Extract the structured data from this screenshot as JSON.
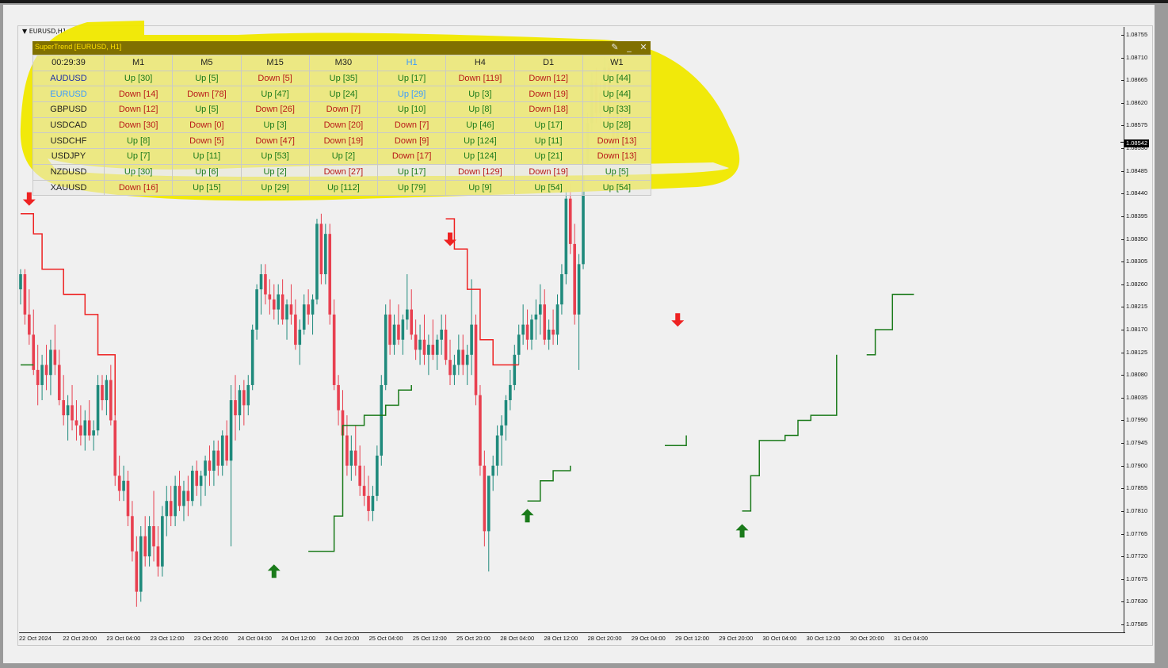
{
  "window": {
    "title": "EURUSD,H1"
  },
  "panel": {
    "title": "SuperTrend [EURUSD, H1]",
    "pin_icon": "pin-icon",
    "minimize_icon": "minimize-icon",
    "close_icon": "close-icon",
    "timer": "00:29:39",
    "timeframes": [
      "M1",
      "M5",
      "M15",
      "M30",
      "H1",
      "H4",
      "D1",
      "W1"
    ],
    "active_timeframe": "H1",
    "active_pair": "EURUSD",
    "rows": [
      {
        "pair": "AUDUSD",
        "cells": [
          "Up [30]",
          "Up [5]",
          "Down [5]",
          "Up [35]",
          "Up [17]",
          "Down [119]",
          "Down [12]",
          "Up [44]"
        ]
      },
      {
        "pair": "EURUSD",
        "cells": [
          "Down [14]",
          "Down [78]",
          "Up [47]",
          "Up [24]",
          "Up [29]",
          "Up [3]",
          "Down [19]",
          "Up [44]"
        ]
      },
      {
        "pair": "GBPUSD",
        "cells": [
          "Down [12]",
          "Up [5]",
          "Down [26]",
          "Down [7]",
          "Up [10]",
          "Up [8]",
          "Down [18]",
          "Up [33]"
        ]
      },
      {
        "pair": "USDCAD",
        "cells": [
          "Down [30]",
          "Down [0]",
          "Up [3]",
          "Down [20]",
          "Down [7]",
          "Up [46]",
          "Up [17]",
          "Up [28]"
        ]
      },
      {
        "pair": "USDCHF",
        "cells": [
          "Up [8]",
          "Down [5]",
          "Down [47]",
          "Down [19]",
          "Down [9]",
          "Up [124]",
          "Up [11]",
          "Down [13]"
        ]
      },
      {
        "pair": "USDJPY",
        "cells": [
          "Up [7]",
          "Up [11]",
          "Up [53]",
          "Up [2]",
          "Down [17]",
          "Up [124]",
          "Up [21]",
          "Down [13]"
        ]
      },
      {
        "pair": "NZDUSD",
        "cells": [
          "Up [30]",
          "Up [6]",
          "Up [2]",
          "Down [27]",
          "Up [17]",
          "Down [129]",
          "Down [19]",
          "Up [5]"
        ]
      },
      {
        "pair": "XAUUSD",
        "cells": [
          "Down [16]",
          "Up [15]",
          "Up [29]",
          "Up [112]",
          "Up [79]",
          "Up [9]",
          "Up [54]",
          "Up [54]"
        ]
      }
    ]
  },
  "y_axis": {
    "labels": [
      "1.08755",
      "1.08710",
      "1.08665",
      "1.08620",
      "1.08575",
      "1.08530",
      "1.08485",
      "1.08440",
      "1.08395",
      "1.08350",
      "1.08305",
      "1.08260",
      "1.08215",
      "1.08170",
      "1.08125",
      "1.08080",
      "1.08035",
      "1.07990",
      "1.07945",
      "1.07900",
      "1.07855",
      "1.07810",
      "1.07765",
      "1.07720",
      "1.07675",
      "1.07630",
      "1.07585"
    ],
    "current_price": "1.08542"
  },
  "x_axis": {
    "labels": [
      "22 Oct 2024",
      "22 Oct 20:00",
      "23 Oct 04:00",
      "23 Oct 12:00",
      "23 Oct 20:00",
      "24 Oct 04:00",
      "24 Oct 12:00",
      "24 Oct 20:00",
      "25 Oct 04:00",
      "25 Oct 12:00",
      "25 Oct 20:00",
      "28 Oct 04:00",
      "28 Oct 12:00",
      "28 Oct 20:00",
      "29 Oct 04:00",
      "29 Oct 12:00",
      "29 Oct 20:00",
      "30 Oct 04:00",
      "30 Oct 12:00",
      "30 Oct 20:00",
      "31 Oct 04:00"
    ]
  },
  "colors": {
    "bull": "#1f8a7c",
    "bear": "#e84050",
    "supertrend_up": "#1a7a1a",
    "supertrend_down": "#ee2222",
    "highlight": "#f0e800",
    "panel_header": "#807000",
    "active_cell": "#3a9bff"
  },
  "chart_data": {
    "type": "candlestick",
    "symbol": "EURUSD",
    "timeframe": "H1",
    "ylim": [
      1.07585,
      1.08755
    ],
    "current_price": 1.08542,
    "supertrend_up": [
      [
        0,
        1.081
      ],
      [
        3,
        1.081
      ],
      [
        59,
        1.0773
      ],
      [
        67,
        1.0773
      ],
      [
        73,
        1.078
      ],
      [
        75,
        1.0798
      ],
      [
        80,
        1.08
      ],
      [
        85,
        1.0802
      ],
      [
        88,
        1.0805
      ],
      [
        91,
        1.0806
      ],
      [
        99,
        1.0806
      ],
      [
        118,
        1.0783
      ],
      [
        121,
        1.0787
      ],
      [
        124,
        1.0789
      ],
      [
        128,
        1.079
      ],
      [
        140,
        1.0793
      ],
      [
        150,
        1.0794
      ],
      [
        155,
        1.0796
      ],
      [
        168,
        1.0781
      ],
      [
        170,
        1.0788
      ],
      [
        172,
        1.0795
      ],
      [
        178,
        1.0796
      ],
      [
        181,
        1.0799
      ],
      [
        184,
        1.08
      ],
      [
        190,
        1.0812
      ],
      [
        197,
        1.0812
      ],
      [
        199,
        1.0817
      ],
      [
        203,
        1.0824
      ],
      [
        208,
        1.0824
      ]
    ],
    "supertrend_down": [
      [
        0,
        1.084
      ],
      [
        3,
        1.0836
      ],
      [
        5,
        1.0829
      ],
      [
        10,
        1.0824
      ],
      [
        15,
        1.082
      ],
      [
        18,
        1.0812
      ],
      [
        22,
        1.08
      ],
      [
        33,
        1.0798
      ],
      [
        58,
        1.0798
      ],
      [
        99,
        1.0839
      ],
      [
        101,
        1.0833
      ],
      [
        104,
        1.0825
      ],
      [
        107,
        1.0815
      ],
      [
        110,
        1.081
      ],
      [
        116,
        1.081
      ],
      [
        155,
        1.0817
      ],
      [
        163,
        1.0817
      ]
    ],
    "arrows": [
      {
        "i": 2,
        "dir": "down",
        "price": 1.0843
      },
      {
        "i": 59,
        "dir": "up",
        "price": 1.0769
      },
      {
        "i": 100,
        "dir": "down",
        "price": 1.0835
      },
      {
        "i": 118,
        "dir": "up",
        "price": 1.078
      },
      {
        "i": 153,
        "dir": "down",
        "price": 1.0819
      },
      {
        "i": 168,
        "dir": "up",
        "price": 1.0777
      }
    ],
    "candles": [
      [
        1.0825,
        1.0829,
        1.0822,
        1.0828
      ],
      [
        1.0828,
        1.0829,
        1.0818,
        1.082
      ],
      [
        1.082,
        1.0825,
        1.0814,
        1.0816
      ],
      [
        1.0816,
        1.0821,
        1.0808,
        1.0809
      ],
      [
        1.0809,
        1.0814,
        1.0802,
        1.0806
      ],
      [
        1.0806,
        1.0812,
        1.0803,
        1.081
      ],
      [
        1.081,
        1.0814,
        1.0805,
        1.0808
      ],
      [
        1.0808,
        1.0815,
        1.0804,
        1.0813
      ],
      [
        1.0813,
        1.0818,
        1.0808,
        1.081
      ],
      [
        1.081,
        1.0813,
        1.0802,
        1.0803
      ],
      [
        1.0803,
        1.0808,
        1.0798,
        1.08
      ],
      [
        1.08,
        1.0804,
        1.0795,
        1.0802
      ],
      [
        1.0802,
        1.0806,
        1.0797,
        1.0799
      ],
      [
        1.0799,
        1.0803,
        1.0795,
        1.0798
      ],
      [
        1.0798,
        1.0802,
        1.0794,
        1.0796
      ],
      [
        1.0796,
        1.0801,
        1.0793,
        1.0799
      ],
      [
        1.0799,
        1.0803,
        1.0795,
        1.0796
      ],
      [
        1.0796,
        1.0799,
        1.0793,
        1.0797
      ],
      [
        1.0797,
        1.0808,
        1.0796,
        1.0806
      ],
      [
        1.0806,
        1.0808,
        1.0801,
        1.0803
      ],
      [
        1.0803,
        1.0808,
        1.08,
        1.0807
      ],
      [
        1.0807,
        1.081,
        1.0798,
        1.0799
      ],
      [
        1.0799,
        1.0802,
        1.0786,
        1.0788
      ],
      [
        1.0788,
        1.0792,
        1.0783,
        1.0785
      ],
      [
        1.0785,
        1.079,
        1.0783,
        1.0787
      ],
      [
        1.0787,
        1.0789,
        1.0778,
        1.078
      ],
      [
        1.078,
        1.0783,
        1.0771,
        1.0773
      ],
      [
        1.0773,
        1.0776,
        1.0762,
        1.0765
      ],
      [
        1.0765,
        1.0778,
        1.0763,
        1.0776
      ],
      [
        1.0776,
        1.078,
        1.077,
        1.0772
      ],
      [
        1.0772,
        1.078,
        1.077,
        1.0778
      ],
      [
        1.0778,
        1.0785,
        1.0771,
        1.0774
      ],
      [
        1.0774,
        1.0778,
        1.0768,
        1.077
      ],
      [
        1.077,
        1.0782,
        1.0768,
        1.078
      ],
      [
        1.078,
        1.0786,
        1.0776,
        1.0783
      ],
      [
        1.0783,
        1.0786,
        1.0778,
        1.078
      ],
      [
        1.078,
        1.0788,
        1.0778,
        1.0786
      ],
      [
        1.0786,
        1.0789,
        1.0781,
        1.0782
      ],
      [
        1.0782,
        1.0787,
        1.0779,
        1.0785
      ],
      [
        1.0785,
        1.0788,
        1.078,
        1.0783
      ],
      [
        1.0783,
        1.079,
        1.0782,
        1.0789
      ],
      [
        1.0789,
        1.0791,
        1.0784,
        1.0786
      ],
      [
        1.0786,
        1.0789,
        1.0782,
        1.0788
      ],
      [
        1.0788,
        1.0792,
        1.0784,
        1.0791
      ],
      [
        1.0791,
        1.0794,
        1.0786,
        1.0789
      ],
      [
        1.0789,
        1.0795,
        1.0786,
        1.0793
      ],
      [
        1.0793,
        1.0795,
        1.0788,
        1.079
      ],
      [
        1.079,
        1.0797,
        1.0788,
        1.0796
      ],
      [
        1.0796,
        1.0799,
        1.079,
        1.0791
      ],
      [
        1.0791,
        1.0806,
        1.0774,
        1.0803
      ],
      [
        1.0803,
        1.0808,
        1.0795,
        1.08
      ],
      [
        1.08,
        1.0806,
        1.0797,
        1.0805
      ],
      [
        1.0805,
        1.0807,
        1.0798,
        1.0802
      ],
      [
        1.0802,
        1.0808,
        1.08,
        1.0806
      ],
      [
        1.0806,
        1.0818,
        1.0805,
        1.0817
      ],
      [
        1.0817,
        1.0826,
        1.0815,
        1.0825
      ],
      [
        1.0825,
        1.083,
        1.082,
        1.0828
      ],
      [
        1.0828,
        1.083,
        1.0822,
        1.0824
      ],
      [
        1.0824,
        1.0827,
        1.082,
        1.0823
      ],
      [
        1.0823,
        1.0826,
        1.0819,
        1.0821
      ],
      [
        1.0821,
        1.0826,
        1.0818,
        1.0824
      ],
      [
        1.0824,
        1.0827,
        1.0818,
        1.0819
      ],
      [
        1.0819,
        1.0823,
        1.0815,
        1.0822
      ],
      [
        1.0822,
        1.0826,
        1.0818,
        1.082
      ],
      [
        1.082,
        1.0823,
        1.0813,
        1.0814
      ],
      [
        1.0814,
        1.0819,
        1.081,
        1.0817
      ],
      [
        1.0817,
        1.0824,
        1.0816,
        1.0822
      ],
      [
        1.0822,
        1.0825,
        1.0818,
        1.082
      ],
      [
        1.082,
        1.0824,
        1.0816,
        1.0823
      ],
      [
        1.0823,
        1.0839,
        1.0822,
        1.0838
      ],
      [
        1.0838,
        1.084,
        1.0826,
        1.0828
      ],
      [
        1.0828,
        1.0838,
        1.0826,
        1.0836
      ],
      [
        1.0836,
        1.0838,
        1.0818,
        1.082
      ],
      [
        1.082,
        1.0823,
        1.0805,
        1.0806
      ],
      [
        1.0806,
        1.0808,
        1.0798,
        1.0801
      ],
      [
        1.0801,
        1.0805,
        1.0794,
        1.0796
      ],
      [
        1.0796,
        1.08,
        1.0788,
        1.079
      ],
      [
        1.079,
        1.0796,
        1.0787,
        1.0793
      ],
      [
        1.0793,
        1.0798,
        1.0788,
        1.079
      ],
      [
        1.079,
        1.0794,
        1.0784,
        1.0786
      ],
      [
        1.0786,
        1.079,
        1.0782,
        1.0784
      ],
      [
        1.0784,
        1.0788,
        1.0779,
        1.0781
      ],
      [
        1.0781,
        1.0786,
        1.0779,
        1.0784
      ],
      [
        1.0784,
        1.0794,
        1.0783,
        1.0792
      ],
      [
        1.0792,
        1.0808,
        1.079,
        1.0806
      ],
      [
        1.0806,
        1.0822,
        1.0805,
        1.082
      ],
      [
        1.082,
        1.0823,
        1.0812,
        1.0814
      ],
      [
        1.0814,
        1.082,
        1.0812,
        1.0818
      ],
      [
        1.0818,
        1.0822,
        1.0814,
        1.0815
      ],
      [
        1.0815,
        1.082,
        1.0812,
        1.0819
      ],
      [
        1.0819,
        1.0828,
        1.0817,
        1.0821
      ],
      [
        1.0821,
        1.0825,
        1.0815,
        1.0816
      ],
      [
        1.0816,
        1.0819,
        1.0811,
        1.0813
      ],
      [
        1.0813,
        1.0818,
        1.081,
        1.0815
      ],
      [
        1.0815,
        1.082,
        1.081,
        1.0812
      ],
      [
        1.0812,
        1.0816,
        1.0808,
        1.0814
      ],
      [
        1.0814,
        1.0819,
        1.0811,
        1.0812
      ],
      [
        1.0812,
        1.0816,
        1.0809,
        1.0815
      ],
      [
        1.0815,
        1.082,
        1.0812,
        1.0817
      ],
      [
        1.0817,
        1.082,
        1.081,
        1.0811
      ],
      [
        1.0811,
        1.0815,
        1.0806,
        1.0808
      ],
      [
        1.0808,
        1.0812,
        1.0806,
        1.081
      ],
      [
        1.081,
        1.0816,
        1.0808,
        1.0813
      ],
      [
        1.0813,
        1.0816,
        1.0808,
        1.081
      ],
      [
        1.081,
        1.0814,
        1.0806,
        1.0812
      ],
      [
        1.0812,
        1.0827,
        1.0808,
        1.0818
      ],
      [
        1.0818,
        1.082,
        1.0802,
        1.0804
      ],
      [
        1.0804,
        1.0806,
        1.0788,
        1.079
      ],
      [
        1.079,
        1.0793,
        1.0774,
        1.0777
      ],
      [
        1.0777,
        1.0784,
        1.0769,
        1.0788
      ],
      [
        1.0788,
        1.0792,
        1.0785,
        1.079
      ],
      [
        1.079,
        1.0798,
        1.0788,
        1.0796
      ],
      [
        1.0796,
        1.08,
        1.079,
        1.0798
      ],
      [
        1.0798,
        1.0804,
        1.0795,
        1.0803
      ],
      [
        1.0803,
        1.0809,
        1.0801,
        1.0806
      ],
      [
        1.0806,
        1.0814,
        1.0805,
        1.0812
      ],
      [
        1.0812,
        1.0818,
        1.081,
        1.0816
      ],
      [
        1.0816,
        1.0822,
        1.0814,
        1.0818
      ],
      [
        1.0818,
        1.0821,
        1.0813,
        1.0815
      ],
      [
        1.0815,
        1.082,
        1.0813,
        1.0819
      ],
      [
        1.0819,
        1.0823,
        1.0815,
        1.082
      ],
      [
        1.082,
        1.0826,
        1.0816,
        1.0822
      ],
      [
        1.0822,
        1.0825,
        1.0814,
        1.0815
      ],
      [
        1.0815,
        1.0819,
        1.0813,
        1.0817
      ],
      [
        1.0817,
        1.0821,
        1.0814,
        1.0816
      ],
      [
        1.0816,
        1.0824,
        1.0814,
        1.0822
      ],
      [
        1.0822,
        1.083,
        1.082,
        1.0828
      ],
      [
        1.0828,
        1.0845,
        1.0826,
        1.0843
      ],
      [
        1.0843,
        1.0846,
        1.0832,
        1.0834
      ],
      [
        1.0834,
        1.0838,
        1.0818,
        1.082
      ],
      [
        1.082,
        1.0832,
        1.0809,
        1.083
      ],
      [
        1.083,
        1.0852,
        1.0829,
        1.085
      ],
      [
        1.085,
        1.086,
        1.0848,
        1.0858
      ],
      [
        1.0858,
        1.0868,
        1.0856,
        1.0866
      ],
      [
        1.0866,
        1.0869,
        1.0858,
        1.086
      ],
      [
        1.086,
        1.0866,
        1.0857,
        1.0864
      ],
      [
        1.0864,
        1.0871,
        1.0862,
        1.0869
      ],
      [
        1.0869,
        1.087,
        1.0856,
        1.0858
      ],
      [
        1.0858,
        1.0862,
        1.0852,
        1.0853
      ],
      [
        1.0853,
        1.086,
        1.0852,
        1.0858
      ],
      [
        1.0858,
        1.0861,
        1.0853,
        1.0859
      ],
      [
        1.0859,
        1.086,
        1.0853,
        1.0854
      ]
    ]
  }
}
